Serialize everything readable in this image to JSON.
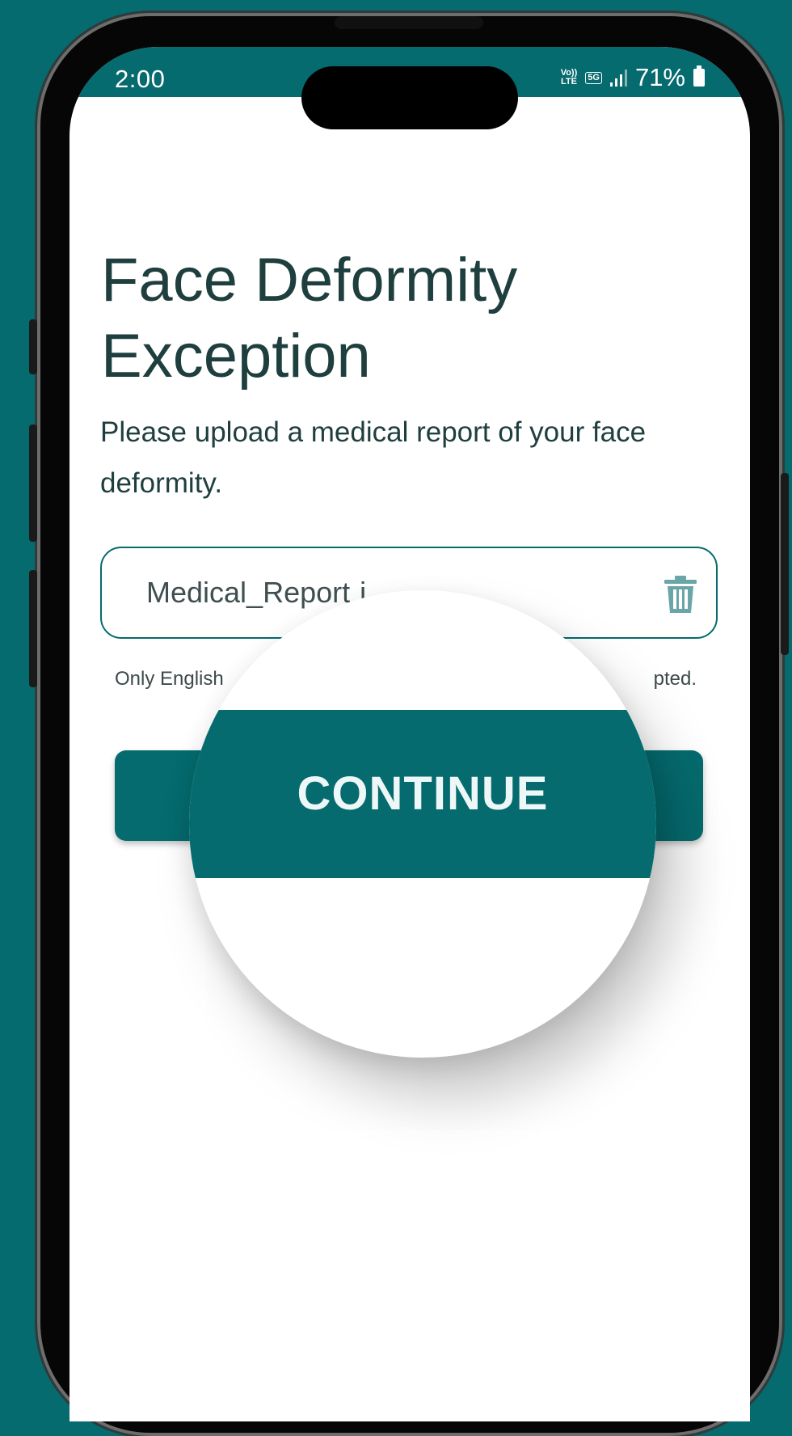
{
  "status_bar": {
    "time": "2:00",
    "volte": "Vo)) LTE",
    "network": "5G",
    "battery": "71%"
  },
  "page": {
    "title": "Face Deformity Exception",
    "description": "Please upload a medical report of your face deformity."
  },
  "upload": {
    "file_name": "Medical_Report",
    "file_name_fragment": "i",
    "hint_visible_left": "Only English",
    "hint_visible_right": "pted."
  },
  "actions": {
    "continue_label": "CONTINUE"
  },
  "colors": {
    "brand_teal": "#056b6e",
    "text_dark": "#1f3e3e",
    "trash_icon": "#6aa5a7"
  },
  "icons": {
    "delete": "trash-icon",
    "battery": "battery-icon",
    "signal": "signal-icon"
  }
}
